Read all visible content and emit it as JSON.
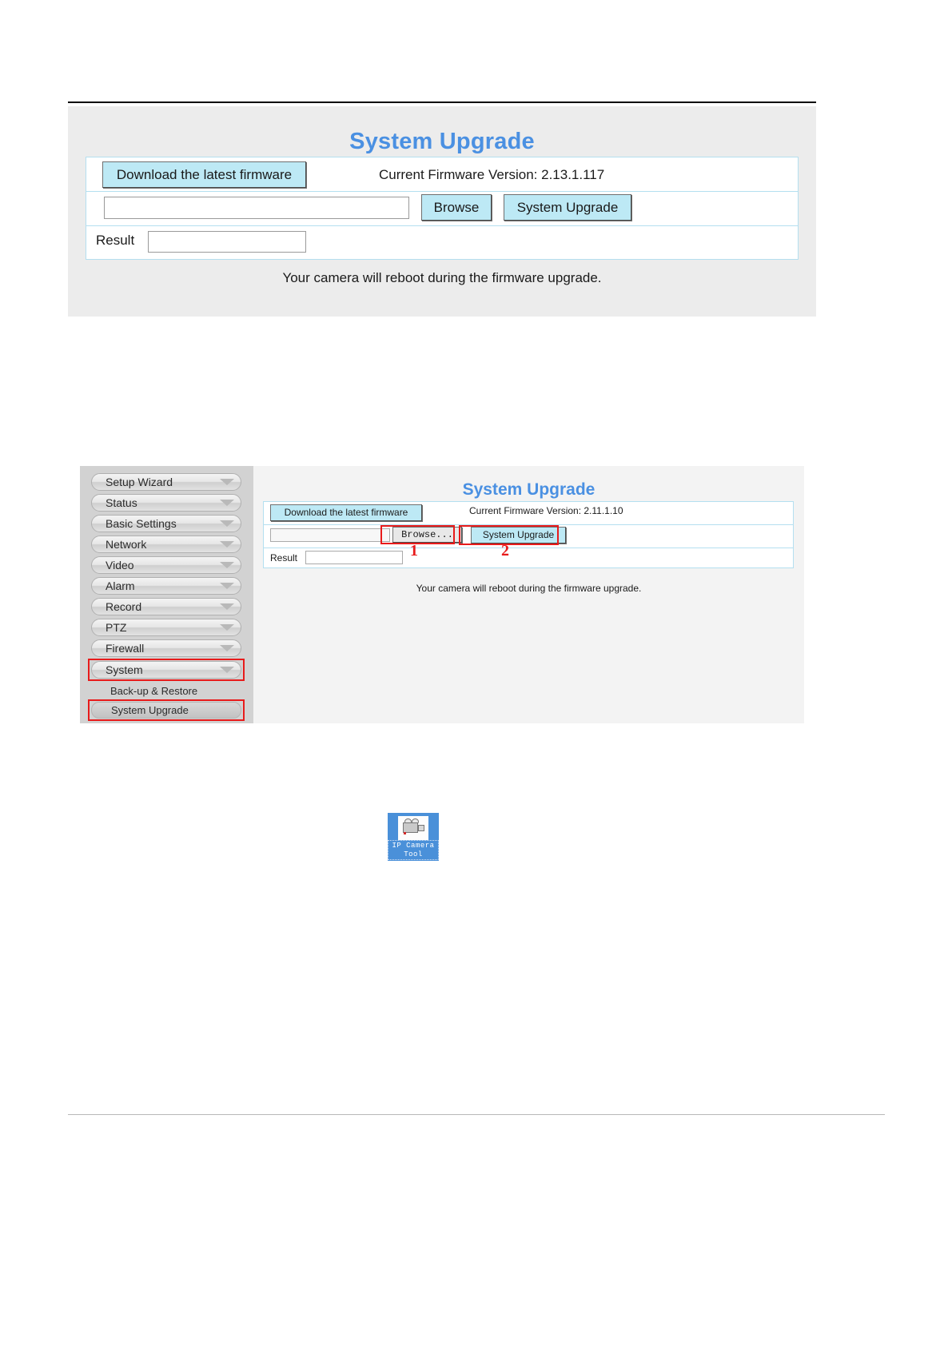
{
  "figure1": {
    "title": "System Upgrade",
    "download_button": "Download the latest firmware",
    "firmware_version_text": "Current Firmware Version: 2.13.1.117",
    "file_path_value": "",
    "browse_button": "Browse",
    "upgrade_button": "System Upgrade",
    "result_label": "Result",
    "result_value": "",
    "note": "Your camera will reboot during the firmware upgrade.",
    "title_color": "#4a90e2",
    "button_color": "#bde9f5"
  },
  "figure2": {
    "title": "System Upgrade",
    "download_button": "Download the latest firmware",
    "firmware_version_text": "Current Firmware Version: 2.11.1.10",
    "file_path_value": "",
    "browse_button": "Browse...",
    "upgrade_button": "System Upgrade",
    "result_label": "Result",
    "result_value": "",
    "note": "Your camera will reboot during the firmware upgrade.",
    "marker_1": "1",
    "marker_2": "2",
    "highlight_color": "#e81b1b",
    "sidebar": {
      "items": [
        {
          "label": "Setup Wizard"
        },
        {
          "label": "Status"
        },
        {
          "label": "Basic Settings"
        },
        {
          "label": "Network"
        },
        {
          "label": "Video"
        },
        {
          "label": "Alarm"
        },
        {
          "label": "Record"
        },
        {
          "label": "PTZ"
        },
        {
          "label": "Firewall"
        },
        {
          "label": "System"
        }
      ],
      "sub_items": [
        {
          "label": "Back-up & Restore"
        },
        {
          "label": "System Upgrade"
        }
      ]
    }
  },
  "desktop_icon": {
    "label_line1": "IP Camera",
    "label_line2": "Tool",
    "selection_color": "#4a90d9"
  }
}
